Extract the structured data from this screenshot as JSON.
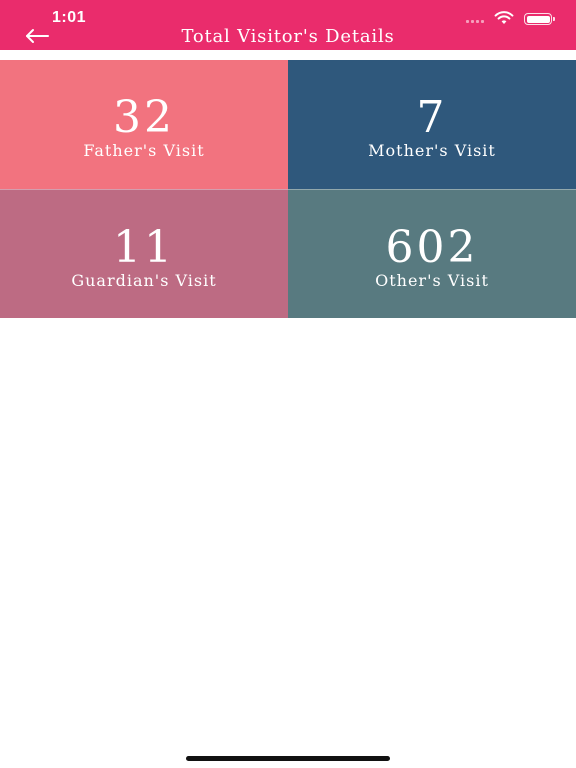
{
  "status_bar": {
    "time": "1:01",
    "battery_level": 1.0,
    "icons": [
      "signal-icon",
      "wifi-icon",
      "battery-icon"
    ]
  },
  "nav": {
    "title": "Total Visitor's Details",
    "back_icon": "arrow-left-icon"
  },
  "colors": {
    "header": "#ea2c6c",
    "father": "#f2737f",
    "mother": "#2f587c",
    "guardian": "#bd6b83",
    "other": "#587a80"
  },
  "tiles": [
    {
      "count": "32",
      "label": "Father's Visit"
    },
    {
      "count": "7",
      "label": "Mother's Visit"
    },
    {
      "count": "11",
      "label": "Guardian's Visit"
    },
    {
      "count": "602",
      "label": "Other's Visit"
    }
  ]
}
